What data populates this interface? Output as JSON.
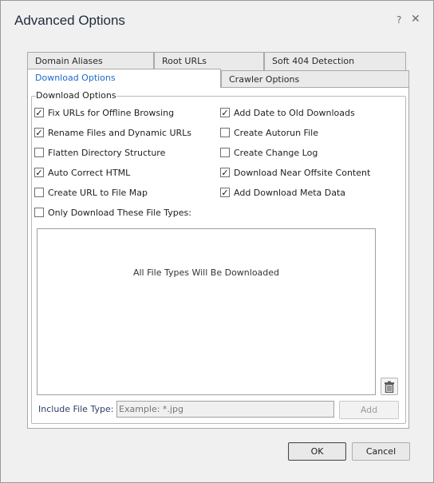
{
  "dialog": {
    "title": "Advanced Options",
    "help_glyph": "?",
    "close_glyph": "✕"
  },
  "tabs": [
    {
      "label": "Domain Aliases"
    },
    {
      "label": "Root URLs"
    },
    {
      "label": "Soft 404 Detection"
    },
    {
      "label": "Download Options",
      "active": true
    },
    {
      "label": "Crawler Options"
    }
  ],
  "group": {
    "label": "Download Options"
  },
  "options": [
    {
      "label": "Fix URLs for Offline Browsing",
      "checked": true
    },
    {
      "label": "Rename Files and Dynamic URLs",
      "checked": true
    },
    {
      "label": "Flatten Directory Structure",
      "checked": false
    },
    {
      "label": "Auto Correct HTML",
      "checked": true
    },
    {
      "label": "Create URL to File Map",
      "checked": false
    },
    {
      "label": "Add Date to Old Downloads",
      "checked": true
    },
    {
      "label": "Create Autorun File",
      "checked": false
    },
    {
      "label": "Create Change Log",
      "checked": false
    },
    {
      "label": "Download Near Offsite Content",
      "checked": true
    },
    {
      "label": "Add Download Meta Data",
      "checked": true
    },
    {
      "label": "Only Download These File Types:",
      "checked": false
    }
  ],
  "file_list": {
    "empty_message": "All File Types Will Be Downloaded"
  },
  "include": {
    "label": "Include File Type:",
    "placeholder": "Example: *.jpg",
    "add_label": "Add"
  },
  "footer": {
    "ok_label": "OK",
    "cancel_label": "Cancel"
  },
  "icons": {
    "delete": "trash-icon",
    "help": "help-icon",
    "close": "close-icon"
  }
}
